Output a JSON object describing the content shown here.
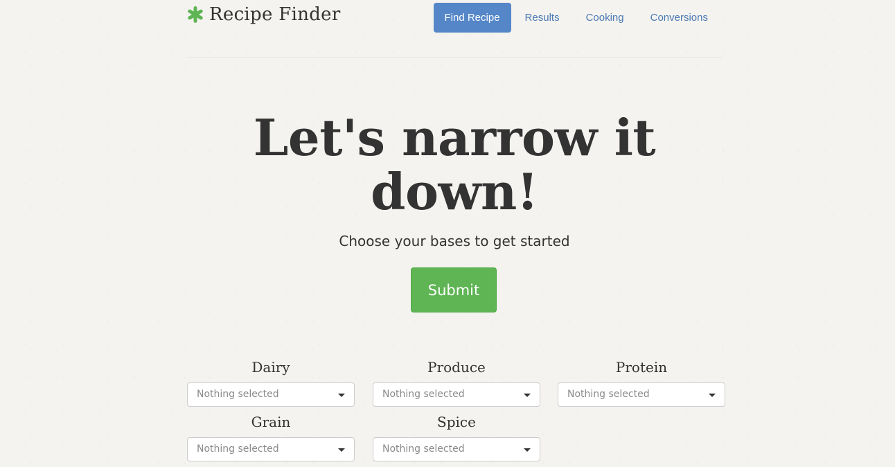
{
  "header": {
    "brand": "Recipe Finder",
    "brand_icon": "asterisk-icon",
    "brand_icon_color": "#5fb554",
    "nav": [
      {
        "label": "Find Recipe",
        "active": true
      },
      {
        "label": "Results",
        "active": false
      },
      {
        "label": "Cooking",
        "active": false
      },
      {
        "label": "Conversions",
        "active": false
      }
    ]
  },
  "hero": {
    "title": "Let's narrow it down!",
    "subtitle": "Choose your bases to get started",
    "submit_label": "Submit"
  },
  "filters": [
    {
      "label": "Dairy",
      "selected": "Nothing selected"
    },
    {
      "label": "Produce",
      "selected": "Nothing selected"
    },
    {
      "label": "Protein",
      "selected": "Nothing selected"
    },
    {
      "label": "Grain",
      "selected": "Nothing selected"
    },
    {
      "label": "Spice",
      "selected": "Nothing selected"
    }
  ],
  "colors": {
    "accent": "#5486c8",
    "link": "#4a79b5",
    "submit": "#5fb554"
  }
}
